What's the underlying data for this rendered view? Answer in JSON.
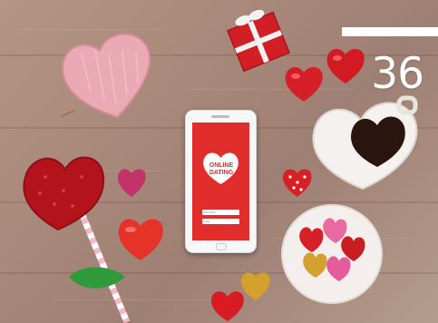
{
  "page": {
    "number": "36"
  },
  "phone": {
    "screen_title_line1": "ONLINE",
    "screen_title_line2": "DATING",
    "field_1_label": "Username",
    "field_2_label": "Login"
  },
  "colors": {
    "wood": "#a8887a",
    "accent_red": "#d21f26",
    "phone_screen": "#e22d2d",
    "pink_knit": "#e9a9b5",
    "white": "#ffffff"
  },
  "objects": [
    "pink-knitted-heart-icon",
    "red-gift-box-icon",
    "red-heart-candies",
    "heart-shaped-coffee-cup",
    "red-glitter-heart-lollipop",
    "smartphone",
    "plate-of-heart-candies",
    "gold-heart-candy"
  ]
}
